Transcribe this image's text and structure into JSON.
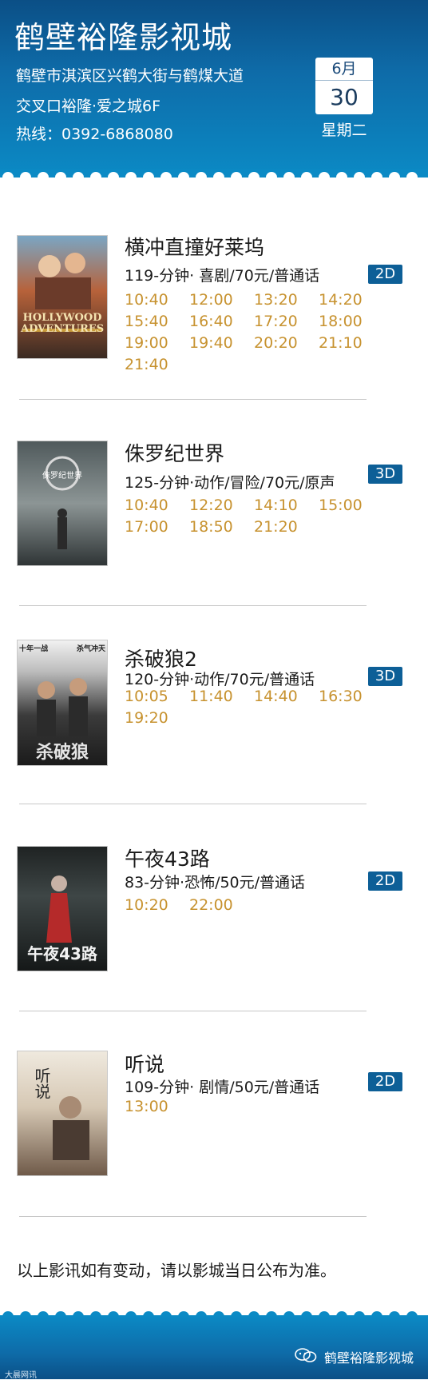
{
  "header": {
    "cinema_name": "鹤壁裕隆影视城",
    "address_line1": "鹤壁市淇滨区兴鹤大街与鹤煤大道",
    "address_line2": "交叉口裕隆·爱之城6F",
    "hotline": "热线：0392-6868080",
    "date_month": "6月",
    "date_day": "30",
    "date_weekday": "星期二"
  },
  "colors": {
    "header_blue": "#0b6aa6",
    "badge_blue": "#0d5f97",
    "time_gold": "#c7922f"
  },
  "movies": [
    {
      "title": "横冲直撞好莱坞",
      "info": "119-分钟· 喜剧/70元/普通话",
      "format": "2D",
      "times": [
        "10:40",
        "12:00",
        "13:20",
        "14:20",
        "15:40",
        "16:40",
        "17:20",
        "18:00",
        "19:00",
        "19:40",
        "20:20",
        "21:10",
        "21:40"
      ],
      "poster_text": "HOLLYWOOD ADVENTURES"
    },
    {
      "title": "侏罗纪世界",
      "info": "125-分钟·动作/冒险/70元/原声",
      "format": "3D",
      "times": [
        "10:40",
        "12:20",
        "14:10",
        "15:00",
        "17:00",
        "18:50",
        "21:20"
      ],
      "poster_text": "侏罗纪世界"
    },
    {
      "title": "杀破狼2",
      "info": "120-分钟·动作/70元/普通话",
      "format": "3D",
      "times": [
        "10:05",
        "11:40",
        "14:40",
        "16:30",
        "19:20"
      ],
      "poster_text": "杀破狼",
      "poster_tag_left": "十年一战",
      "poster_tag_right": "杀气冲天"
    },
    {
      "title": "午夜43路",
      "info": "83-分钟·恐怖/50元/普通话",
      "format": "2D",
      "times": [
        "10:20",
        "22:00"
      ],
      "poster_text": "午夜43路"
    },
    {
      "title": "听说",
      "info": "109-分钟· 剧情/50元/普通话",
      "format": "2D",
      "times": [
        "13:00"
      ],
      "poster_text": "听说"
    }
  ],
  "notice": "以上影讯如有变动，请以影城当日公布为准。",
  "footer": {
    "account_name": "鹤壁裕隆影视城",
    "watermark": "大晨网讯"
  }
}
